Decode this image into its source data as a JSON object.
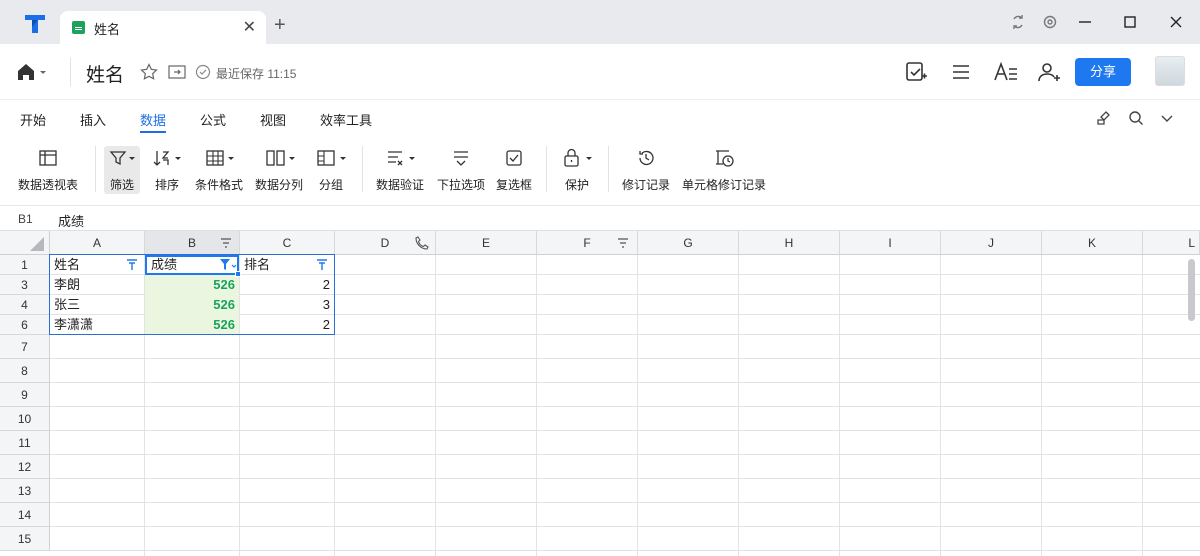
{
  "tab": {
    "title": "姓名"
  },
  "header": {
    "doc_name": "姓名",
    "save_status": "最近保存 11:15",
    "share_label": "分享"
  },
  "menu_tabs": [
    "开始",
    "插入",
    "数据",
    "公式",
    "视图",
    "效率工具"
  ],
  "active_menu_tab": "数据",
  "toolbar": [
    {
      "label": "数据透视表",
      "icon": "pivot-table-icon"
    },
    {
      "label": "筛选",
      "icon": "filter-icon",
      "active": true
    },
    {
      "label": "排序",
      "icon": "sort-icon"
    },
    {
      "label": "条件格式",
      "icon": "conditional-format-icon"
    },
    {
      "label": "数据分列",
      "icon": "split-column-icon"
    },
    {
      "label": "分组",
      "icon": "group-icon"
    },
    {
      "label": "数据验证",
      "icon": "data-validation-icon"
    },
    {
      "label": "下拉选项",
      "icon": "dropdown-options-icon"
    },
    {
      "label": "复选框",
      "icon": "checkbox-icon"
    },
    {
      "label": "保护",
      "icon": "lock-icon"
    },
    {
      "label": "修订记录",
      "icon": "history-icon"
    },
    {
      "label": "单元格修订记录",
      "icon": "cell-history-icon"
    }
  ],
  "formula_bar": {
    "cell_ref": "B1",
    "content": "成绩"
  },
  "columns": [
    "A",
    "B",
    "C",
    "D",
    "E",
    "F",
    "G",
    "H",
    "I",
    "J",
    "K",
    "L"
  ],
  "rows": [
    "1",
    "3",
    "4",
    "6",
    "7",
    "8",
    "9",
    "10",
    "11",
    "12",
    "13",
    "14",
    "15"
  ],
  "cells": {
    "r1": [
      "姓名",
      "成绩",
      "排名"
    ],
    "r3": [
      "李朗",
      "526",
      "2"
    ],
    "r4": [
      "张三",
      "526",
      "3"
    ],
    "r6": [
      "李潇潇",
      "526",
      "2"
    ]
  },
  "colors": {
    "accent": "#1e6fe6",
    "share": "#1e78f0",
    "green_value": "#1aa35a",
    "selection_fill": "#eaf6e0"
  }
}
